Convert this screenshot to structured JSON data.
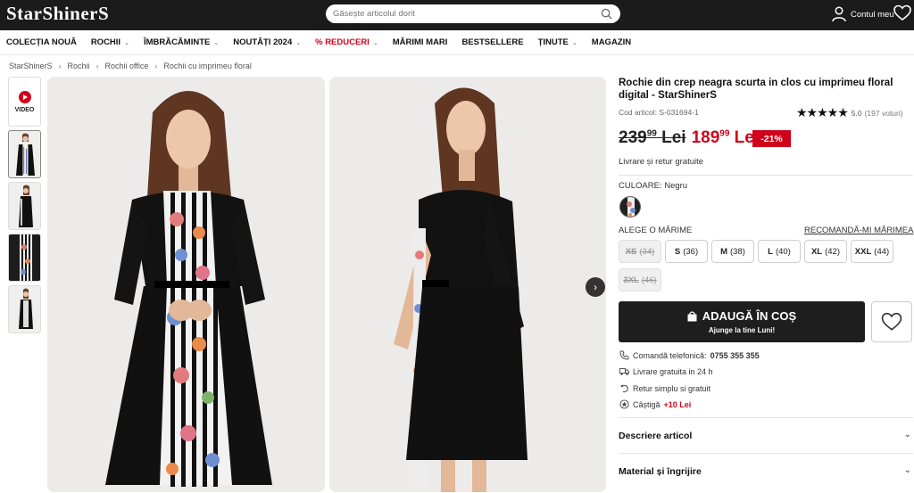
{
  "header": {
    "logo": "StarShinerS",
    "search_placeholder": "Găsește articolul dorit",
    "account_label": "Contul meu"
  },
  "nav": [
    {
      "label": "COLECȚIA NOUĂ",
      "chevron": false
    },
    {
      "label": "ROCHII",
      "chevron": true
    },
    {
      "label": "ÎMBRĂCĂMINTE",
      "chevron": true
    },
    {
      "label": "NOUTĂȚI 2024",
      "chevron": true
    },
    {
      "label": "% REDUCERI",
      "chevron": true,
      "accent": "#d0021b"
    },
    {
      "label": "MĂRIMI MARI",
      "chevron": false
    },
    {
      "label": "BESTSELLERE",
      "chevron": false
    },
    {
      "label": "ȚINUTE",
      "chevron": true
    },
    {
      "label": "MAGAZIN",
      "chevron": false
    }
  ],
  "breadcrumb": [
    "StarShinerS",
    "Rochii",
    "Rochii office",
    "Rochii cu imprimeu floral"
  ],
  "gallery": {
    "video_label": "VIDEO",
    "thumbnail_count": 4
  },
  "product": {
    "title": "Rochie din crep neagra scurta in clos cu imprimeu floral digital - StarShinerS",
    "sku": "Cod articol: S-031694-1",
    "rating": "5.0",
    "rating_count": "(197 voturi)",
    "stars": 5,
    "old_price_int": "239",
    "old_price_dec": "99",
    "new_price_int": "189",
    "new_price_dec": "99",
    "currency": "Lei",
    "discount": "-21%",
    "shipping_note": "Livrare și retur gratuite",
    "color_label": "CULOARE: Negru",
    "size_label": "ALEGE O MĂRIME",
    "size_recommend": "RECOMANDĂ-MI MĂRIMEA",
    "sizes": [
      {
        "label": "XS",
        "num": "(34)",
        "available": false
      },
      {
        "label": "S",
        "num": "(36)",
        "available": true
      },
      {
        "label": "M",
        "num": "(38)",
        "available": true
      },
      {
        "label": "L",
        "num": "(40)",
        "available": true
      },
      {
        "label": "XL",
        "num": "(42)",
        "available": true
      },
      {
        "label": "XXL",
        "num": "(44)",
        "available": true
      },
      {
        "label": "3XL",
        "num": "(46)",
        "available": false
      }
    ],
    "add_to_cart": "ADAUGĂ ÎN COȘ",
    "add_to_cart_sub": "Ajunge la tine Luni!",
    "perks": {
      "phone_label": "Comandă telefonică:",
      "phone_number": "0755 355 355",
      "free_delivery": "Livrare gratuita in 24 h",
      "return": "Retur simplu si gratuit",
      "earn_label": "Câștigă",
      "earn_value": "+10 Lei"
    },
    "accordion": [
      "Descriere articol",
      "Material și îngrijire"
    ]
  },
  "colors": {
    "accent": "#d0021b",
    "topbar": "#1b1b1b",
    "button": "#1e1e1e"
  }
}
